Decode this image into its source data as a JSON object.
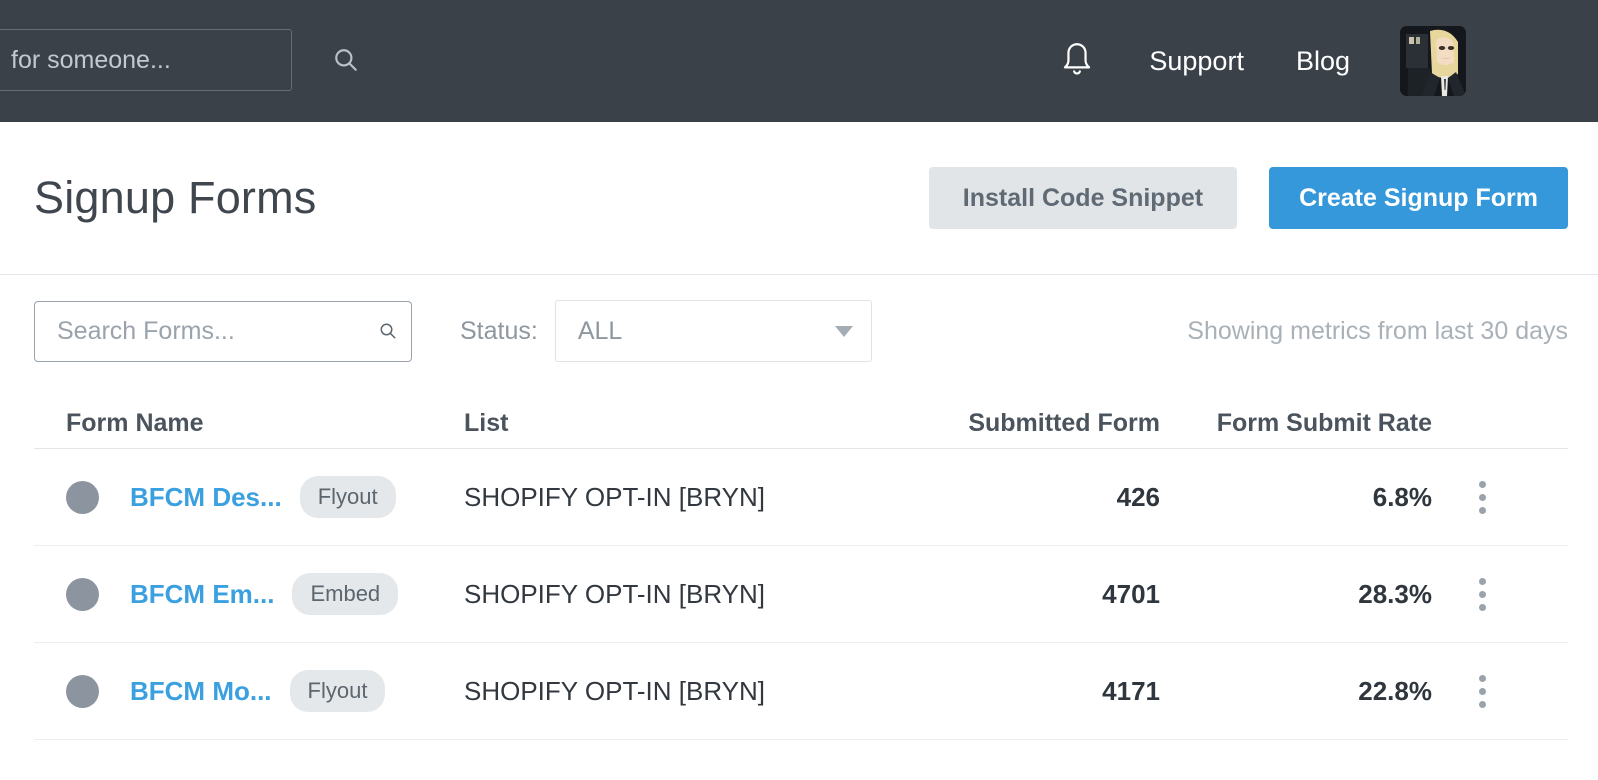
{
  "topnav": {
    "search": {
      "value": "for someone...",
      "placeholder": "Search for someone...",
      "icon": "search-icon"
    },
    "bell_icon": "notification-bell-icon",
    "links": [
      {
        "label": "Support"
      },
      {
        "label": "Blog"
      }
    ],
    "avatar_alt": "user-avatar",
    "background_color": "#3a4149"
  },
  "page_header": {
    "title": "Signup Forms",
    "install_button": "Install Code Snippet",
    "create_button": "Create Signup Form",
    "primary_color": "#3498db",
    "secondary_color": "#e2e5e7"
  },
  "filters": {
    "search_placeholder": "Search Forms...",
    "search_value": "",
    "search_icon": "search-icon",
    "status_label": "Status:",
    "status_value": "ALL",
    "status_options": [
      "ALL"
    ],
    "metrics_note": "Showing metrics from last 30 days"
  },
  "table": {
    "columns": [
      {
        "key": "name",
        "label": "Form Name"
      },
      {
        "key": "list",
        "label": "List"
      },
      {
        "key": "submitted",
        "label": "Submitted Form"
      },
      {
        "key": "rate",
        "label": "Form Submit Rate"
      },
      {
        "key": "menu",
        "label": ""
      }
    ],
    "rows": [
      {
        "status_color": "#8b949f",
        "name": "BFCM Des...",
        "badge": "Flyout",
        "list": "SHOPIFY OPT-IN [BRYN]",
        "submitted": "426",
        "rate": "6.8%",
        "menu_icon": "kebab-menu-icon"
      },
      {
        "status_color": "#8b949f",
        "name": "BFCM Em...",
        "badge": "Embed",
        "list": "SHOPIFY OPT-IN [BRYN]",
        "submitted": "4701",
        "rate": "28.3%",
        "menu_icon": "kebab-menu-icon"
      },
      {
        "status_color": "#8b949f",
        "name": "BFCM Mo...",
        "badge": "Flyout",
        "list": "SHOPIFY OPT-IN [BRYN]",
        "submitted": "4171",
        "rate": "22.8%",
        "menu_icon": "kebab-menu-icon"
      }
    ]
  }
}
